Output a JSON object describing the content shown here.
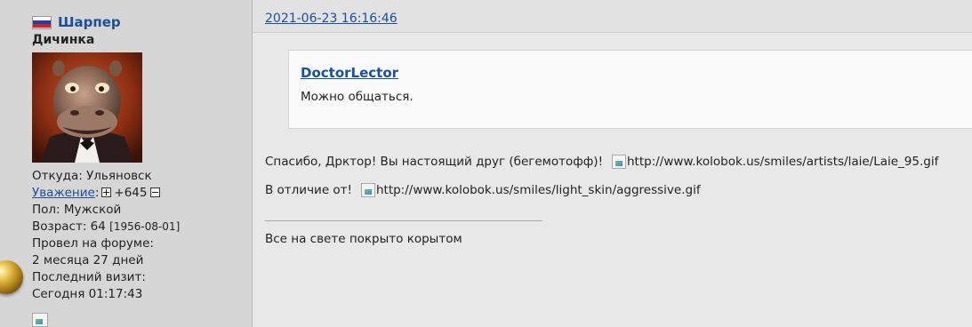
{
  "user": {
    "flag_icon": "russia-flag-icon",
    "name": "Шарпер",
    "title": "Дичинка",
    "avatar_icon": "hippo-avatar",
    "location": "Откуда: Ульяновск",
    "reputation_label": "Уважение",
    "reputation_sep": ":",
    "reputation_value": "+645",
    "gender": "Пол: Мужской",
    "age": "Возраст: 64",
    "birth_date": "[1956-08-01]",
    "time_on_forum_label": "Провел на форуме:",
    "time_on_forum_value": "2 месяца 27 дней",
    "last_visit_label": "Последний визит:",
    "last_visit_value": "Сегодня 01:17:43"
  },
  "post": {
    "date": "2021-06-23 16:16:46",
    "quote": {
      "author": "DoctorLector",
      "text": "Можно общаться."
    },
    "line1": "Спасибо, Дрктор! Вы настоящий друг (бегемотофф)!",
    "line1_image_alt": "http://www.kolobok.us/smiles/artists/laie/Laie_95.gif",
    "line2": "В отличие от!",
    "line2_image_alt": "http://www.kolobok.us/smiles/light_skin/aggressive.gif",
    "signature": "Все на свете покрыто корытом"
  },
  "colors": {
    "link": "#1a4f9a",
    "sidebar_bg": "#d6d6d6",
    "content_bg": "#e8e8e8",
    "quote_bg": "#fafafa"
  }
}
